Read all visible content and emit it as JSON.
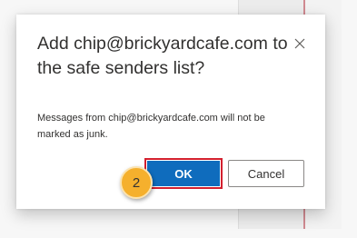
{
  "dialog": {
    "title": "Add chip@brickyardcafe.com to the safe senders list?",
    "message": "Messages from chip@brickyardcafe.com will not be marked as junk.",
    "close_icon": "close-icon",
    "ok_label": "OK",
    "cancel_label": "Cancel"
  },
  "annotation": {
    "step_number": "2"
  },
  "colors": {
    "primary_button": "#0f6cbd",
    "highlight_border": "#d3202f",
    "step_badge": "#f5b02d"
  }
}
